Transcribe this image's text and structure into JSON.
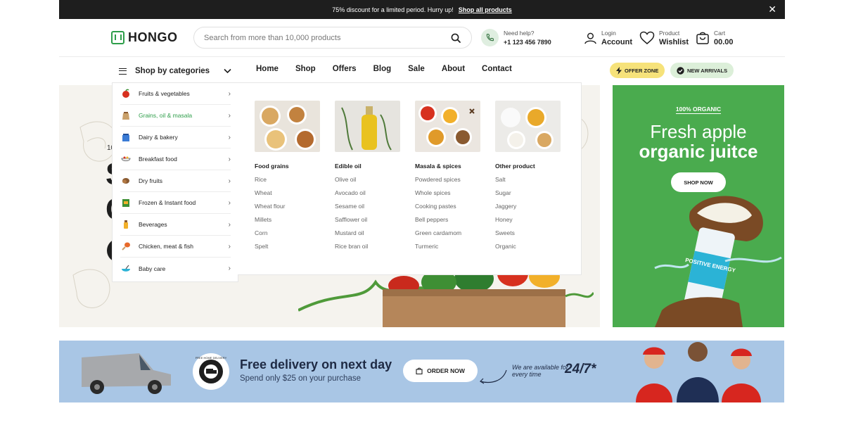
{
  "announcement": {
    "text": "75% discount for a limited period. Hurry up!",
    "link": "Shop all products",
    "close": "✕"
  },
  "header": {
    "logo": "HONGO",
    "search_placeholder": "Search from more than 10,000 products",
    "help_label": "Need help?",
    "help_phone": "+1 123 456 7890",
    "login_label": "Login",
    "account_label": "Account",
    "wishlist_small": "Product",
    "wishlist_label": "Wishlist",
    "cart_small": "Cart",
    "cart_total": "00.00"
  },
  "nav": {
    "categories_label": "Shop by categories",
    "links": [
      "Home",
      "Shop",
      "Offers",
      "Blog",
      "Sale",
      "About",
      "Contact"
    ],
    "offer_zone": "OFFER ZONE",
    "new_arrivals": "NEW ARRIVALS"
  },
  "categories": [
    {
      "label": "Fruits & vegetables",
      "icon": "fruit-icon"
    },
    {
      "label": "Grains, oil & masala",
      "icon": "grain-sack-icon"
    },
    {
      "label": "Dairy & bakery",
      "icon": "dairy-icon"
    },
    {
      "label": "Breakfast food",
      "icon": "bowl-icon"
    },
    {
      "label": "Dry fruits",
      "icon": "nut-icon"
    },
    {
      "label": "Frozen & Instant food",
      "icon": "frozen-icon"
    },
    {
      "label": "Beverages",
      "icon": "bottle-icon"
    },
    {
      "label": "Chicken, meat & fish",
      "icon": "drumstick-icon"
    },
    {
      "label": "Baby care",
      "icon": "baby-bowl-icon"
    }
  ],
  "mega_menu": [
    {
      "title": "Food grains",
      "items": [
        "Rice",
        "Wheat",
        "Wheat flour",
        "Millets",
        "Corn",
        "Spelt"
      ]
    },
    {
      "title": "Edible oil",
      "items": [
        "Olive oil",
        "Avocado oil",
        "Sesame oil",
        "Safflower oil",
        "Mustard oil",
        "Rice bran oil"
      ]
    },
    {
      "title": "Masala & spices",
      "items": [
        "Powdered spices",
        "Whole spices",
        "Cooking pastes",
        "Bell peppers",
        "Green cardamom",
        "Turmeric"
      ]
    },
    {
      "title": "Other product",
      "items": [
        "Salt",
        "Sugar",
        "Jaggery",
        "Honey",
        "Sweets",
        "Organic"
      ]
    }
  ],
  "hero": {
    "partial_label": "10",
    "partial_big_1": "S",
    "partial_big_2": "C"
  },
  "side_banner": {
    "tag": "100% ORGANIC",
    "line1": "Fresh apple",
    "line2": "organic juitce",
    "button": "SHOP NOW",
    "can_text": "POSITIVE ENERGY"
  },
  "delivery_banner": {
    "title": "Free delivery on next day",
    "subtitle": "Spend only $25 on your purchase",
    "button": "ORDER NOW",
    "available": "We are available for every time",
    "hours": "24/7*",
    "seal_text": "FREE HOME DELIVERY"
  },
  "colors": {
    "brand_green": "#2e9e4a",
    "offer_yellow": "#f6e27a",
    "arrivals_green": "#dcefd9",
    "banner_green": "#4aab4e",
    "banner_blue": "#a9c6e5"
  }
}
